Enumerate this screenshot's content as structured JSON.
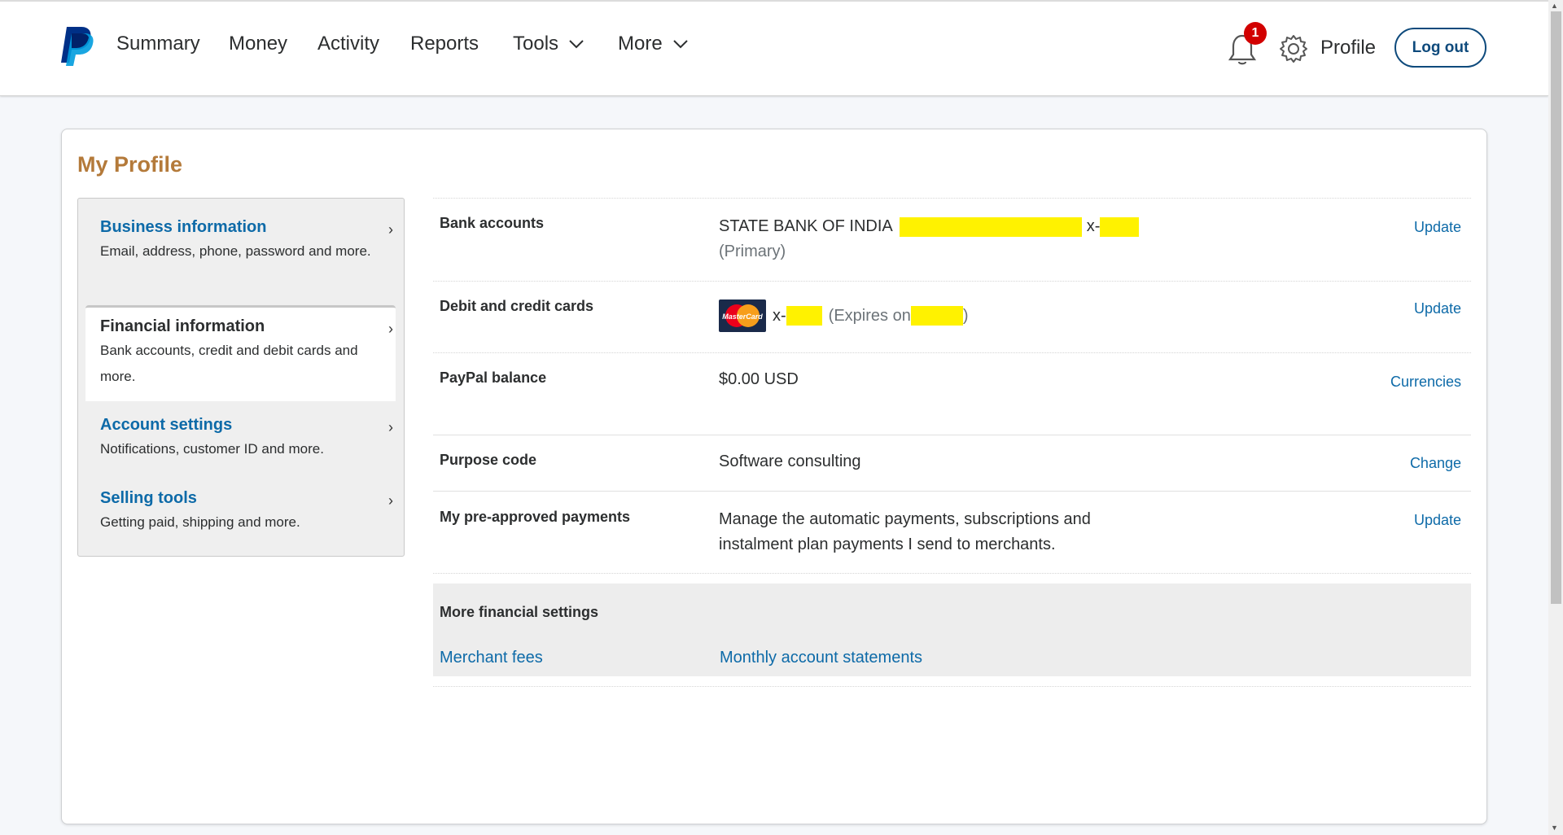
{
  "nav": {
    "items": [
      "Summary",
      "Money",
      "Activity",
      "Reports",
      "Tools",
      "More"
    ],
    "notification_count": "1",
    "profile_label": "Profile",
    "logout_label": "Log out"
  },
  "page_title": "My Profile",
  "sidebar": {
    "items": [
      {
        "title": "Business information",
        "desc": "Email, address, phone, password and more."
      },
      {
        "title": "Financial information",
        "desc": "Bank accounts, credit and debit cards and more."
      },
      {
        "title": "Account settings",
        "desc": "Notifications, customer ID and more."
      },
      {
        "title": "Selling tools",
        "desc": "Getting paid, shipping and more."
      }
    ],
    "active_index": 1
  },
  "rows": {
    "bank": {
      "label": "Bank accounts",
      "bank_name": "STATE BANK OF INDIA",
      "mask_prefix": "x-",
      "primary": "(Primary)",
      "action": "Update"
    },
    "cards": {
      "label": "Debit and credit cards",
      "mask_prefix": "x-",
      "expires_prefix": "(Expires on",
      "expires_suffix": ")",
      "action": "Update",
      "card_brand_text": "MasterCard"
    },
    "balance": {
      "label": "PayPal balance",
      "value": "$0.00 USD",
      "action": "Currencies"
    },
    "purpose": {
      "label": "Purpose code",
      "value": "Software consulting",
      "action": "Change"
    },
    "preapproved": {
      "label": "My pre-approved payments",
      "value_line1": "Manage the automatic payments, subscriptions and",
      "value_line2": "instalment plan payments I send to merchants.",
      "action": "Update"
    }
  },
  "more_financial": {
    "title": "More financial settings",
    "links": [
      "Merchant fees",
      "Monthly account statements"
    ]
  },
  "colors": {
    "accent_link": "#0d6aa8",
    "title_brown": "#b47a3a",
    "logout_navy": "#0e4a7c",
    "badge_red": "#d20000",
    "redaction_yellow": "#fff200"
  }
}
